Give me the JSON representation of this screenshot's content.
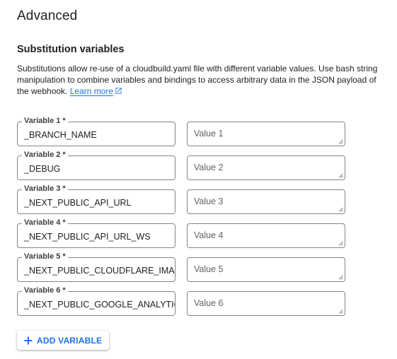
{
  "section": {
    "title": "Advanced"
  },
  "substitutions": {
    "heading": "Substitution variables",
    "description": "Substitutions allow re-use of a cloudbuild.yaml file with different variable values. Use bash string manipulation to combine variables and bindings to access arbitrary data in the JSON payload of the webhook.",
    "learn_more_label": "Learn more",
    "learn_more_icon": "open-in-new-icon",
    "variables": [
      {
        "label": "Variable 1 *",
        "value": "_BRANCH_NAME",
        "value_placeholder": "Value 1",
        "value_value": ""
      },
      {
        "label": "Variable 2 *",
        "value": "_DEBUG",
        "value_placeholder": "Value 2",
        "value_value": ""
      },
      {
        "label": "Variable 3 *",
        "value": "_NEXT_PUBLIC_API_URL",
        "value_placeholder": "Value 3",
        "value_value": ""
      },
      {
        "label": "Variable 4 *",
        "value": "_NEXT_PUBLIC_API_URL_WS",
        "value_placeholder": "Value 4",
        "value_value": ""
      },
      {
        "label": "Variable 5 *",
        "value": "_NEXT_PUBLIC_CLOUDFLARE_IMAGES",
        "value_placeholder": "Value 5",
        "value_value": ""
      },
      {
        "label": "Variable 6 *",
        "value": "_NEXT_PUBLIC_GOOGLE_ANALYTICS",
        "value_placeholder": "Value 6",
        "value_value": ""
      }
    ],
    "add_button_label": "ADD VARIABLE",
    "add_button_icon": "plus-icon"
  },
  "colors": {
    "accent": "#1a73e8",
    "text": "#202124",
    "border": "#80868b",
    "placeholder": "#5f6368"
  }
}
